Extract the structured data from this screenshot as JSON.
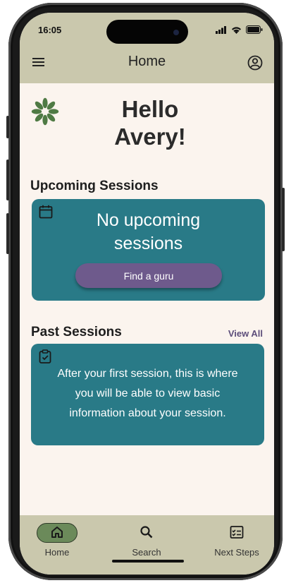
{
  "status_bar": {
    "time": "16:05"
  },
  "app_bar": {
    "title": "Home",
    "menu_icon": "menu-icon",
    "account_icon": "account-circle-icon"
  },
  "greeting": {
    "line1": "Hello",
    "line2": "Avery!"
  },
  "upcoming": {
    "heading": "Upcoming Sessions",
    "icon": "calendar-icon",
    "empty_line1": "No upcoming",
    "empty_line2": "sessions",
    "button_label": "Find a guru"
  },
  "past": {
    "heading": "Past Sessions",
    "view_all_label": "View All",
    "icon": "clipboard-check-icon",
    "line1": "After your first session, this is where",
    "line2": "you will be able to view basic",
    "line3": "information about your session."
  },
  "bottom_nav": {
    "items": [
      {
        "label": "Home",
        "icon": "home-icon",
        "active": true
      },
      {
        "label": "Search",
        "icon": "search-icon",
        "active": false
      },
      {
        "label": "Next Steps",
        "icon": "checklist-icon",
        "active": false
      }
    ]
  },
  "colors": {
    "app_bar": "#cac8ad",
    "background": "#fbf4ee",
    "card": "#297a87",
    "button": "#6e5a8c",
    "active_nav": "#6b8a5a",
    "logo": "#4f7a44"
  }
}
